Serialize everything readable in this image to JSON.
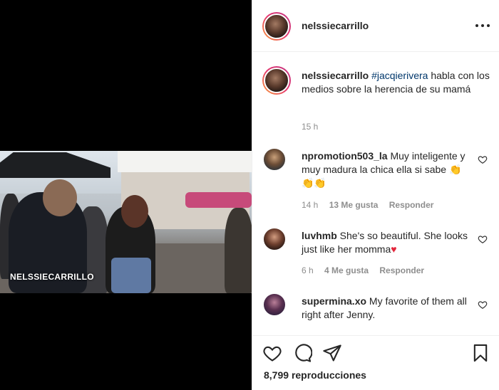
{
  "video": {
    "watermark": "NELSSIECARRILLO"
  },
  "header": {
    "username": "nelssiecarrillo",
    "more_icon": "more-horizontal-icon"
  },
  "caption": {
    "username": "nelssiecarrillo",
    "mention": "#jacqierivera",
    "text": "habla con los medios sobre la herencia de su mamá",
    "time": "15 h"
  },
  "comments": [
    {
      "username": "npromotion503_la",
      "text": "Muy inteligente y muy madura la chica ella si sabe",
      "emoji": "👏👏👏",
      "time": "14 h",
      "likes": "13 Me gusta",
      "reply": "Responder"
    },
    {
      "username": "luvhmb",
      "text": "She's so beautiful. She looks just like her momma",
      "emoji": "♥",
      "time": "6 h",
      "likes": "4 Me gusta",
      "reply": "Responder"
    },
    {
      "username": "supermina.xo",
      "text": "My favorite of them all right after Jenny."
    }
  ],
  "footer": {
    "views_count": "8,799",
    "views_label": "reproducciones",
    "icons": [
      "heart-icon",
      "comment-icon",
      "share-icon",
      "bookmark-icon"
    ]
  }
}
